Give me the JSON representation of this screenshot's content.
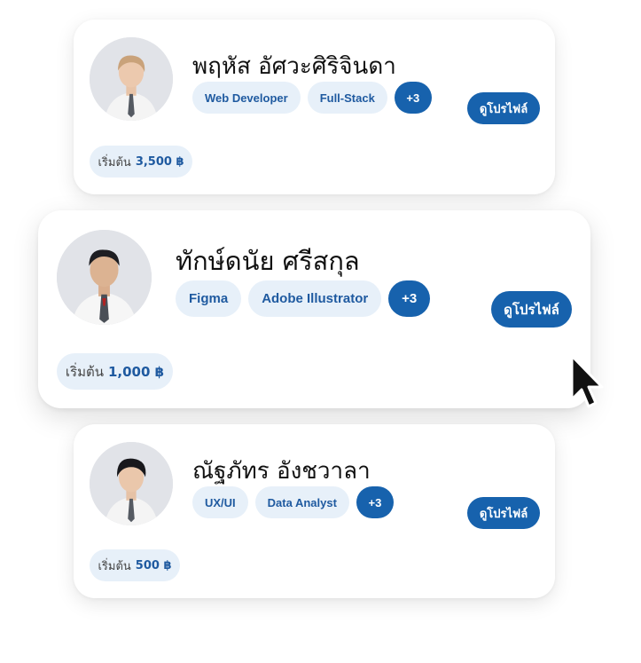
{
  "profiles": [
    {
      "name": "พฤหัส อัศวะศิริจินดา",
      "tags": [
        "Web Developer",
        "Full-Stack"
      ],
      "more": "+3",
      "button_label": "ดูโปรไฟล์",
      "price_label": "เริ่มต้น",
      "price_value": "3,500 ฿"
    },
    {
      "name": "ทักษ์ดนัย ศรีสกุล",
      "tags": [
        "Figma",
        "Adobe Illustrator"
      ],
      "more": "+3",
      "button_label": "ดูโปรไฟล์",
      "price_label": "เริ่มต้น",
      "price_value": "1,000 ฿"
    },
    {
      "name": "ณัฐภัทร อังชวาลา",
      "tags": [
        "UX/UI",
        "Data Analyst"
      ],
      "more": "+3",
      "button_label": "ดูโปรไฟล์",
      "price_label": "เริ่มต้น",
      "price_value": "500 ฿"
    }
  ],
  "icons": {
    "avatar": "person-avatar-icon",
    "cursor": "mouse-pointer-icon"
  },
  "colors": {
    "accent": "#1762ad",
    "tag_bg": "#e7f0f9",
    "tag_text": "#1f5aa0"
  }
}
